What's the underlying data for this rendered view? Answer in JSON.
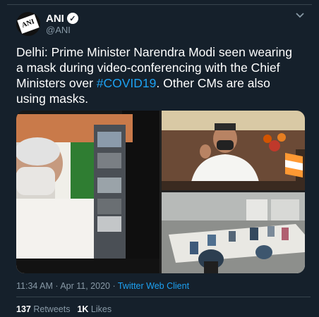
{
  "author": {
    "display_name": "ANI",
    "handle": "@ANI",
    "avatar_text": "ANI",
    "verified_glyph": "✓"
  },
  "tweet": {
    "text_before": "Delhi: Prime Minister Narendra Modi seen wearing a mask during video-conferencing with the Chief Ministers over ",
    "hashtag": "#COVID19",
    "text_after": ". Other CMs are also using masks."
  },
  "meta": {
    "time": "11:34 AM",
    "separator1": " · ",
    "date": "Apr 11, 2020",
    "separator2": " · ",
    "client": "Twitter Web Client"
  },
  "stats": {
    "retweets_count": "137",
    "retweets_label": "Retweets",
    "likes_count": "1K",
    "likes_label": "Likes"
  },
  "icons": {
    "menu_caret": "chevron-down-icon"
  },
  "colors": {
    "background": "#15202b",
    "link": "#1da1f2",
    "secondary_text": "#8899a6",
    "border": "#38444d"
  }
}
